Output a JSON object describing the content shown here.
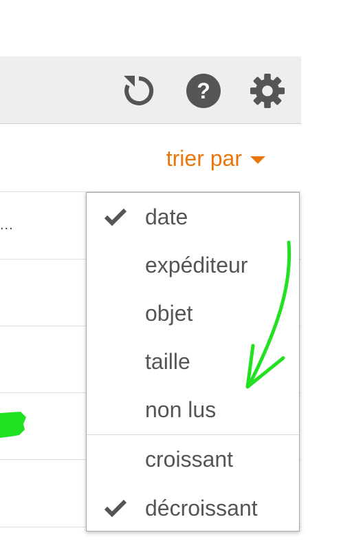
{
  "toolbar": {
    "refresh_icon": "refresh-icon",
    "help_icon": "help-icon",
    "settings_icon": "gear-icon",
    "icon_color": "#555555"
  },
  "sort": {
    "label": "trier par",
    "accent_color": "#e8760c"
  },
  "message_list": {
    "first_row_text": "..."
  },
  "sort_menu": {
    "fields": [
      {
        "label": "date",
        "checked": true
      },
      {
        "label": "expéditeur",
        "checked": false
      },
      {
        "label": "objet",
        "checked": false
      },
      {
        "label": "taille",
        "checked": false
      },
      {
        "label": "non lus",
        "checked": false
      }
    ],
    "order": [
      {
        "label": "croissant",
        "checked": false
      },
      {
        "label": "décroissant",
        "checked": true
      }
    ]
  },
  "annotation": {
    "color": "#22e022"
  }
}
